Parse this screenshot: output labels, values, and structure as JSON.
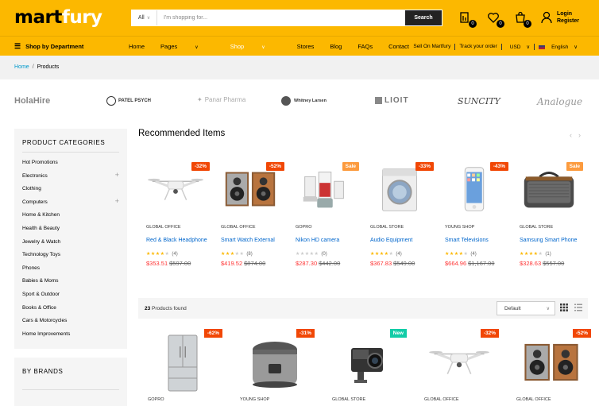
{
  "header": {
    "logo_main": "mart",
    "logo_accent": "fury",
    "search": {
      "category": "All",
      "placeholder": "I'm shopping for...",
      "button": "Search"
    },
    "icons": [
      {
        "name": "compare-icon",
        "count": "0"
      },
      {
        "name": "heart-icon",
        "count": "0"
      },
      {
        "name": "cart-icon",
        "count": "0"
      }
    ],
    "login": "Login",
    "register": "Register"
  },
  "nav": {
    "department": "Shop by Department",
    "menu": [
      "Home",
      "Pages",
      "Shop",
      "Stores",
      "Blog",
      "FAQs",
      "Contact"
    ],
    "sell": "Sell On Martfury",
    "track": "Track your order",
    "currency": "USD",
    "language": "English"
  },
  "breadcrumb": {
    "home": "Home",
    "current": "Products"
  },
  "brands": [
    "HolaHire",
    "PATEL PSYCH",
    "Panar Pharma",
    "Whitney Larsen",
    "LIOIT",
    "SUNCITY",
    "Analogue"
  ],
  "sidebar": {
    "categories_title": "PRODUCT CATEGORIES",
    "categories": [
      {
        "label": "Hot Promotions",
        "plus": ""
      },
      {
        "label": "Electronics",
        "plus": "+"
      },
      {
        "label": "Clothing",
        "plus": ""
      },
      {
        "label": "Computers",
        "plus": "+"
      },
      {
        "label": "Home & Kitchen",
        "plus": ""
      },
      {
        "label": "Health & Beauty",
        "plus": ""
      },
      {
        "label": "Jewelry & Watch",
        "plus": ""
      },
      {
        "label": "Technology Toys",
        "plus": ""
      },
      {
        "label": "Phones",
        "plus": ""
      },
      {
        "label": "Babies & Moms",
        "plus": ""
      },
      {
        "label": "Sport & Outdoor",
        "plus": ""
      },
      {
        "label": "Books & Office",
        "plus": ""
      },
      {
        "label": "Cars & Motorcycles",
        "plus": ""
      },
      {
        "label": "Home Improvements",
        "plus": ""
      }
    ],
    "brands_title": "BY BRANDS"
  },
  "recommended": {
    "title": "Recommended Items",
    "items": [
      {
        "tag": "-32%",
        "tag_type": "red",
        "store": "GLOBAL OFFICE",
        "name": "Red & Black Headphone",
        "stars": 4,
        "reviews": "(4)",
        "price": "$353.51",
        "old_price": "$597.00",
        "image": "drone"
      },
      {
        "tag": "-52%",
        "tag_type": "red",
        "store": "GLOBAL OFFICE",
        "name": "Smart Watch External",
        "stars": 3,
        "reviews": "(8)",
        "price": "$419.52",
        "old_price": "$874.00",
        "image": "speakers"
      },
      {
        "tag": "Sale",
        "tag_type": "orange",
        "store": "GOPRO",
        "name": "Nikon HD camera",
        "stars": 0,
        "reviews": "(0)",
        "price": "$287.30",
        "old_price": "$442.00",
        "image": "blender"
      },
      {
        "tag": "-33%",
        "tag_type": "red",
        "store": "GLOBAL STORE",
        "name": "Audio Equipment",
        "stars": 4,
        "reviews": "(4)",
        "price": "$367.83",
        "old_price": "$549.00",
        "image": "washer"
      },
      {
        "tag": "-43%",
        "tag_type": "red",
        "store": "YOUNG SHOP",
        "name": "Smart Televisions",
        "stars": 4,
        "reviews": "(4)",
        "price": "$664.96",
        "old_price": "$1,167.00",
        "image": "phone"
      },
      {
        "tag": "Sale",
        "tag_type": "orange",
        "store": "GLOBAL STORE",
        "name": "Samsung Smart Phone",
        "stars": 4,
        "reviews": "(1)",
        "price": "$328.63",
        "old_price": "$557.00",
        "image": "radio"
      }
    ]
  },
  "toolbar": {
    "count": "23",
    "count_suffix": "Products found",
    "sort": "Default"
  },
  "products": [
    {
      "tag": "-62%",
      "tag_type": "red",
      "store": "GOPRO",
      "image": "fridge"
    },
    {
      "tag": "-31%",
      "tag_type": "red",
      "store": "YOUNG SHOP",
      "image": "ricecooker"
    },
    {
      "tag": "New",
      "tag_type": "green",
      "store": "GLOBAL STORE",
      "image": "camera"
    },
    {
      "tag": "-32%",
      "tag_type": "red",
      "store": "GLOBAL OFFICE",
      "image": "drone"
    },
    {
      "tag": "-52%",
      "tag_type": "red",
      "store": "GLOBAL OFFICE",
      "image": "speakers"
    }
  ],
  "colors": {
    "brand": "#fcb800",
    "sale_red": "#f14705",
    "sale_orange": "#fc9b3e",
    "new_green": "#12cca7",
    "link": "#0066cc",
    "price": "#ff3333"
  }
}
